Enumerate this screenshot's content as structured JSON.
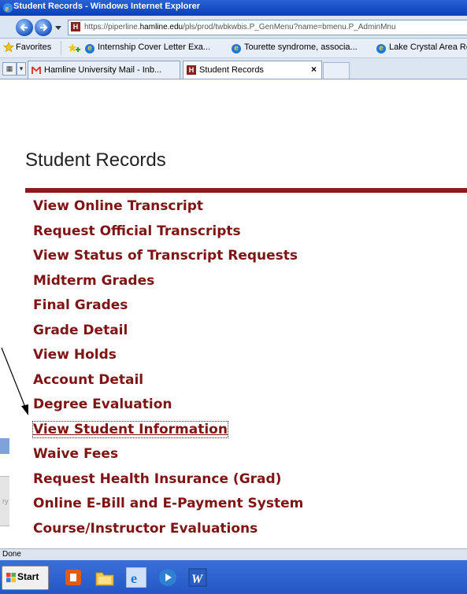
{
  "window": {
    "title": "Student Records - Windows Internet Explorer"
  },
  "address": {
    "url_prefix": "https://piperline.",
    "url_domain": "hamline.edu",
    "url_suffix": "/pls/prod/twbkwbis.P_GenMenu?name=bmenu.P_AdminMnu"
  },
  "favorites": {
    "label": "Favorites",
    "items": [
      "Internship Cover Letter Exa...",
      "Tourette syndrome, associa...",
      "Lake Crystal Area Rec"
    ]
  },
  "tabs": [
    {
      "label": "Hamline University Mail - Inb...",
      "active": false
    },
    {
      "label": "Student Records",
      "active": true
    }
  ],
  "page": {
    "title": "Student Records",
    "menu": [
      "View Online Transcript",
      "Request Official Transcripts",
      "View Status of Transcript Requests",
      "Midterm Grades",
      "Final Grades",
      "Grade Detail",
      "View Holds",
      "Account Detail",
      "Degree Evaluation",
      "View Student Information",
      "Waive Fees",
      "Request Health Insurance (Grad)",
      "Online E-Bill and E-Payment System",
      "Course/Instructor Evaluations"
    ],
    "selected_index": 9
  },
  "status": {
    "text": "Done"
  },
  "taskbar": {
    "start_label": "Start",
    "tab_close": "×",
    "remnant_char": "ry"
  },
  "colors": {
    "link": "#7f1414",
    "rule": "#8b1c1c",
    "titlebar": "#0a3fb8"
  }
}
